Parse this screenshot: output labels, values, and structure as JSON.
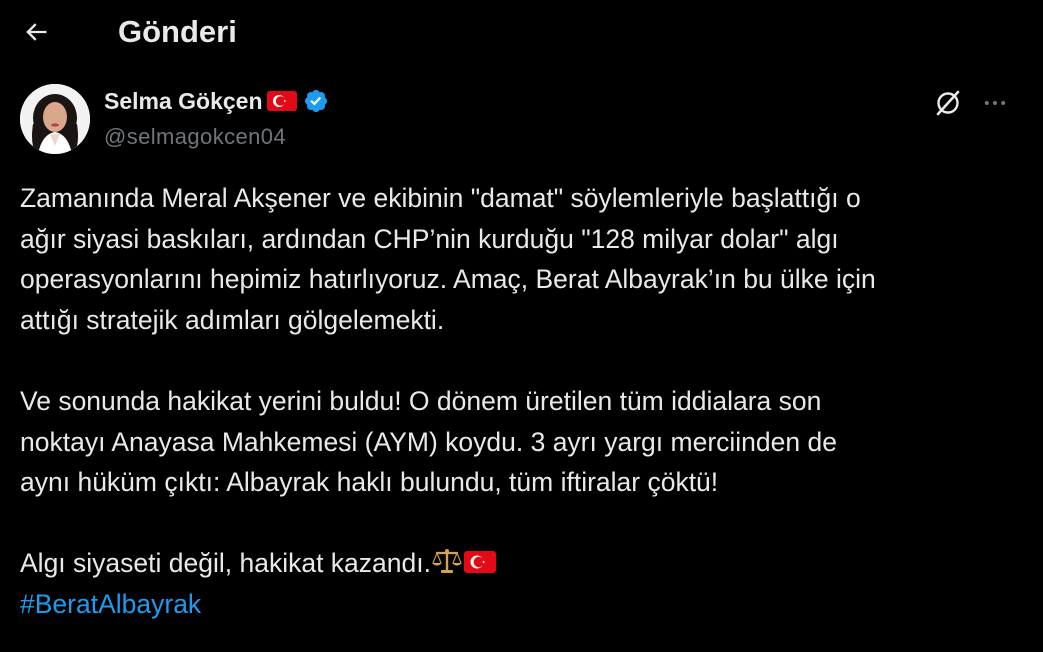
{
  "header": {
    "title": "Gönderi",
    "back_icon": "arrow-left-icon"
  },
  "author": {
    "display_name": "Selma Gökçen",
    "handle": "@selmagokcen04",
    "name_emoji": "turkey-flag-icon",
    "verified_icon": "verified-badge-icon",
    "verified_color": "#1d9bf0"
  },
  "actions": {
    "grok_icon": "grok-icon",
    "more_icon": "more-horizontal-icon"
  },
  "tweet": {
    "paragraph1": "Zamanında Meral Akşener ve ekibinin \"damat\" söylemleriyle başlattığı o\nağır siyasi baskıları, ardından CHP’nin kurduğu \"128 milyar dolar\" algı\noperasyonlarını hepimiz hatırlıyoruz. Amaç, Berat Albayrak’ın bu ülke için\nattığı stratejik adımları gölgelemekti.",
    "paragraph2": "Ve sonunda hakikat yerini buldu! O dönem üretilen tüm iddialara son\nnoktayı Anayasa Mahkemesi (AYM) koydu. 3 ayrı yargı merciinden de\naynı hüküm çıktı: Albayrak haklı bulundu, tüm iftiralar çöktü!",
    "paragraph3": "Algı siyaseti değil, hakikat kazandı.",
    "paragraph3_emojis": [
      "scales-icon",
      "turkey-flag-icon"
    ],
    "hashtag": "#BeratAlbayrak"
  },
  "colors": {
    "background": "#000000",
    "text": "#e7e9ea",
    "secondary_text": "#71767b",
    "link": "#1d9bf0",
    "flag_red": "#e30a17"
  }
}
